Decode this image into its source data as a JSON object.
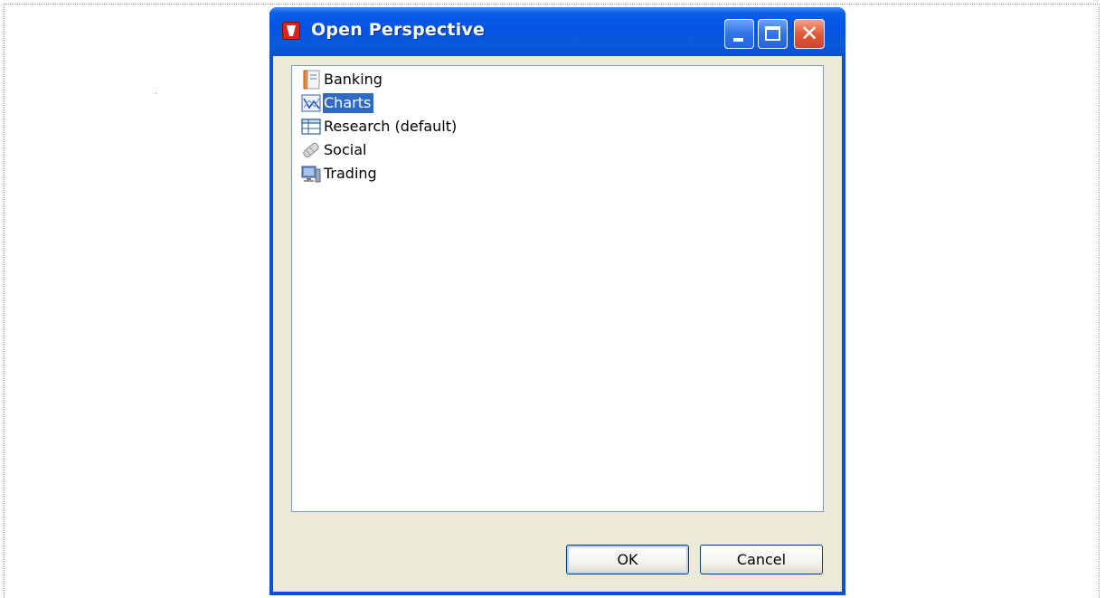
{
  "window": {
    "title": "Open Perspective",
    "icons": {
      "app": "app-icon",
      "minimize": "minimize-icon",
      "maximize": "maximize-icon",
      "close": "close-icon"
    },
    "close_glyph": "✕"
  },
  "perspectives": [
    {
      "label": "Banking",
      "icon": "banking-icon",
      "selected": false
    },
    {
      "label": "Charts",
      "icon": "charts-icon",
      "selected": true
    },
    {
      "label": "Research (default)",
      "icon": "research-icon",
      "selected": false
    },
    {
      "label": "Social",
      "icon": "social-icon",
      "selected": false
    },
    {
      "label": "Trading",
      "icon": "trading-icon",
      "selected": false
    }
  ],
  "buttons": {
    "ok": "OK",
    "cancel": "Cancel"
  },
  "colors": {
    "title_bar": "#0554e3",
    "selection": "#316ac5",
    "dialog_body": "#ece9d8",
    "close_button": "#e25a3a"
  }
}
